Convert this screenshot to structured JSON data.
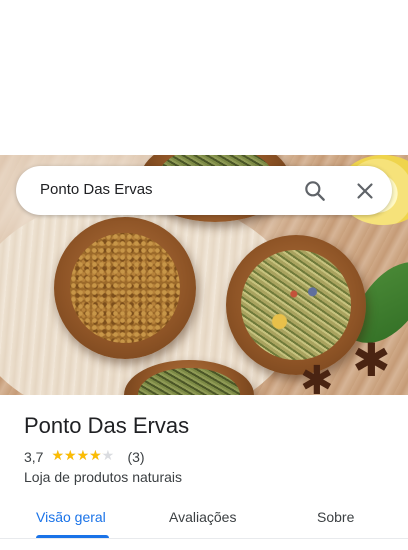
{
  "search": {
    "query": "Ponto Das Ervas"
  },
  "icons": {
    "search": "search-icon",
    "close": "close-icon",
    "star": "star-icon"
  },
  "colors": {
    "accent": "#1a73e8",
    "star": "#fbbc04",
    "star_empty": "#dadce0"
  },
  "place": {
    "name": "Ponto Das Ervas",
    "rating_text": "3,7",
    "rating_value": 3.7,
    "rating_max": 5,
    "review_count": "(3)",
    "category": "Loja de produtos naturais"
  },
  "tabs": [
    {
      "label": "Visão geral",
      "active": true
    },
    {
      "label": "Avaliações",
      "active": false
    },
    {
      "label": "Sobre",
      "active": false
    }
  ]
}
